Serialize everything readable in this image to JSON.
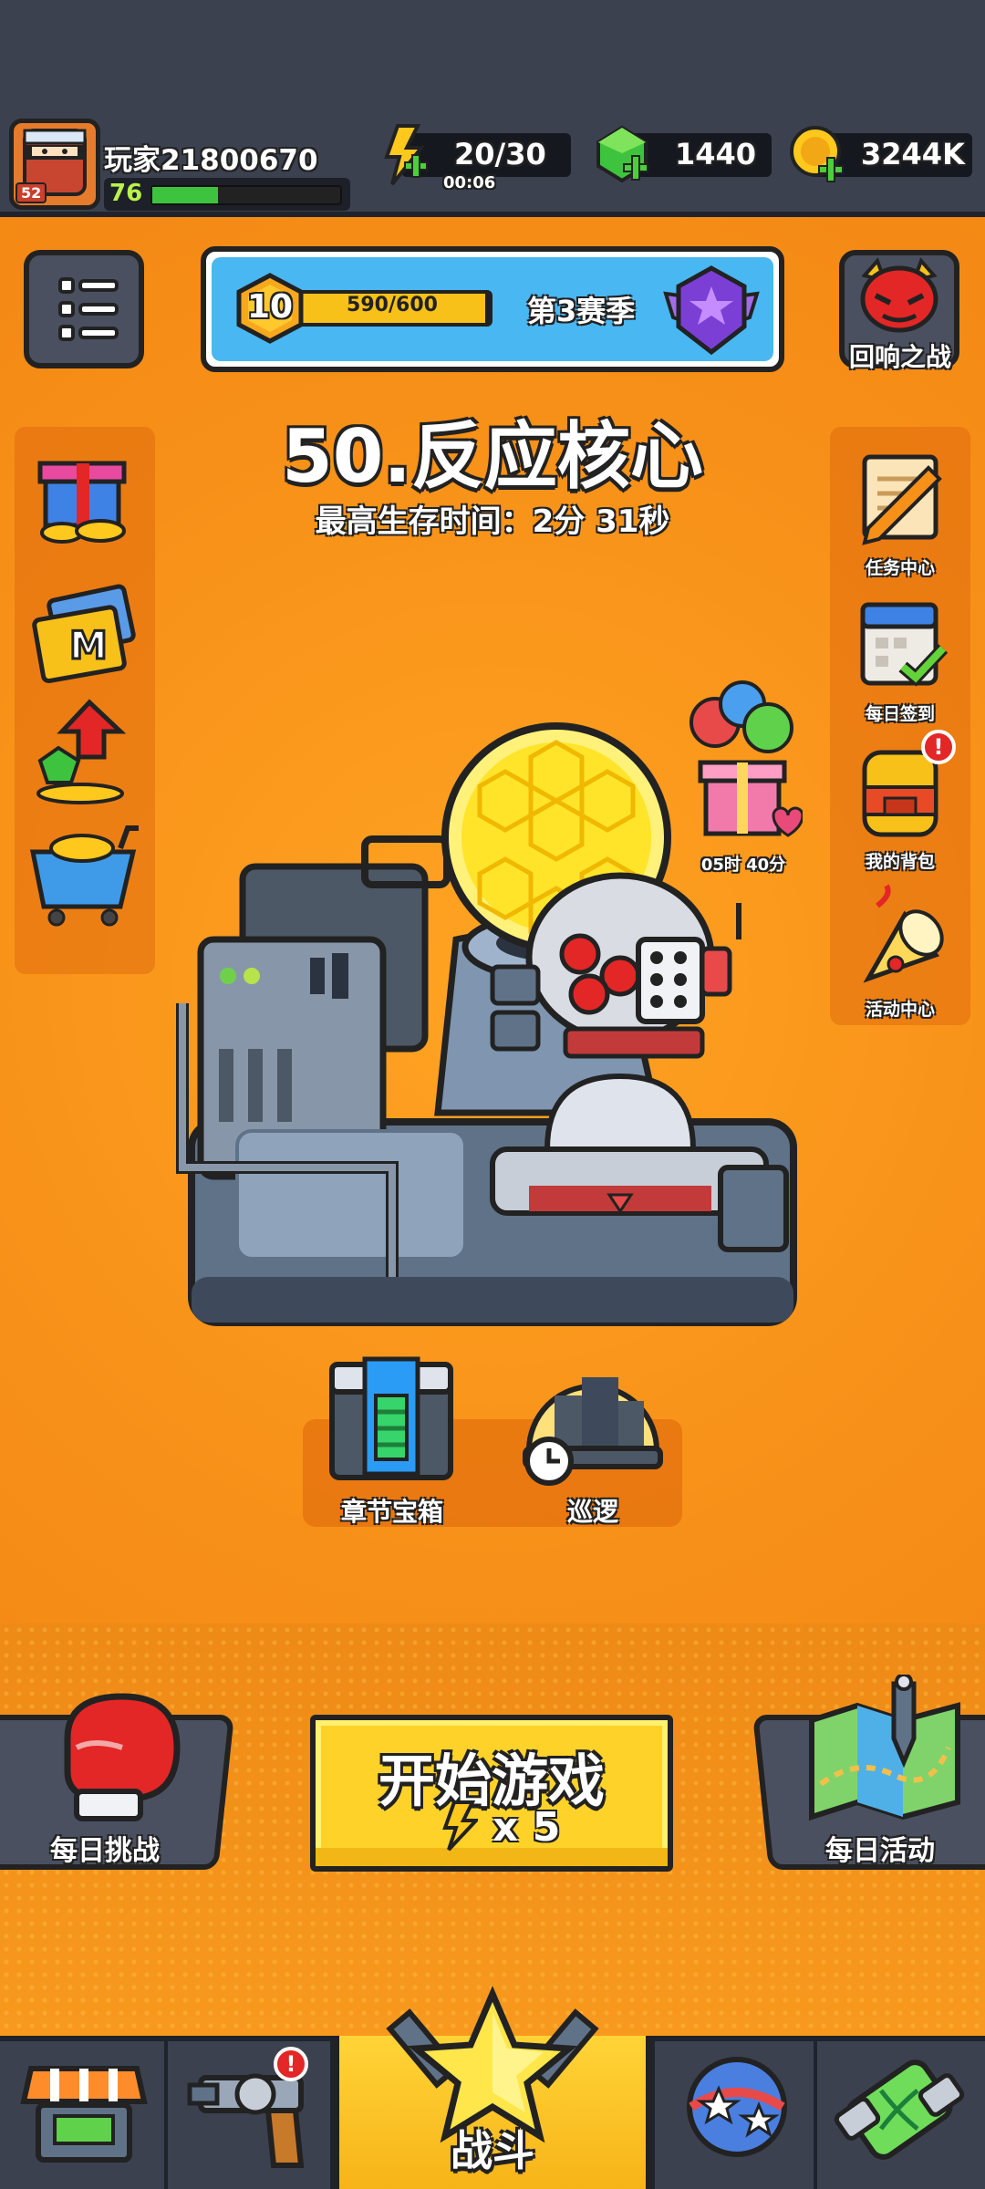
{
  "player": {
    "name": "玩家21800670",
    "level": "76",
    "avatar_level": "52",
    "xp_fraction": 0.35
  },
  "resources": {
    "energy": "20/30",
    "energy_timer": "00:06",
    "gems": "1440",
    "coins": "3244K"
  },
  "season": {
    "level": "10",
    "progress": "590/600",
    "progress_fraction": 0.983,
    "title": "第3赛季"
  },
  "echo_battle": {
    "label": "回响之战"
  },
  "stage": {
    "title": "50.反应核心",
    "best_time": "最高生存时间：2分 31秒"
  },
  "right_menu": [
    {
      "label": "任务中心",
      "icon": "quest-scroll-icon"
    },
    {
      "label": "每日签到",
      "icon": "calendar-check-icon"
    },
    {
      "label": "我的背包",
      "icon": "backpack-icon",
      "alert": "!"
    },
    {
      "label": "活动中心",
      "icon": "party-popper-icon"
    }
  ],
  "left_menu": [
    {
      "icon": "gift-coins-icon"
    },
    {
      "icon": "monthly-card-icon"
    },
    {
      "icon": "growth-gems-icon"
    },
    {
      "icon": "shop-cart-icon"
    }
  ],
  "gift": {
    "timer": "05时 40分"
  },
  "chapter_chest": {
    "label": "章节宝箱"
  },
  "patrol": {
    "label": "巡逻"
  },
  "daily_challenge": {
    "label": "每日挑战"
  },
  "start_game": {
    "label": "开始游戏",
    "cost": "x 5"
  },
  "daily_event": {
    "label": "每日活动"
  },
  "nav": {
    "battle_label": "战斗",
    "weapons_alert": "!"
  },
  "colors": {
    "background": "#f28c14",
    "panel": "#4a5060",
    "accent_yellow": "#ffd22a",
    "season_blue": "#49b7f2"
  }
}
